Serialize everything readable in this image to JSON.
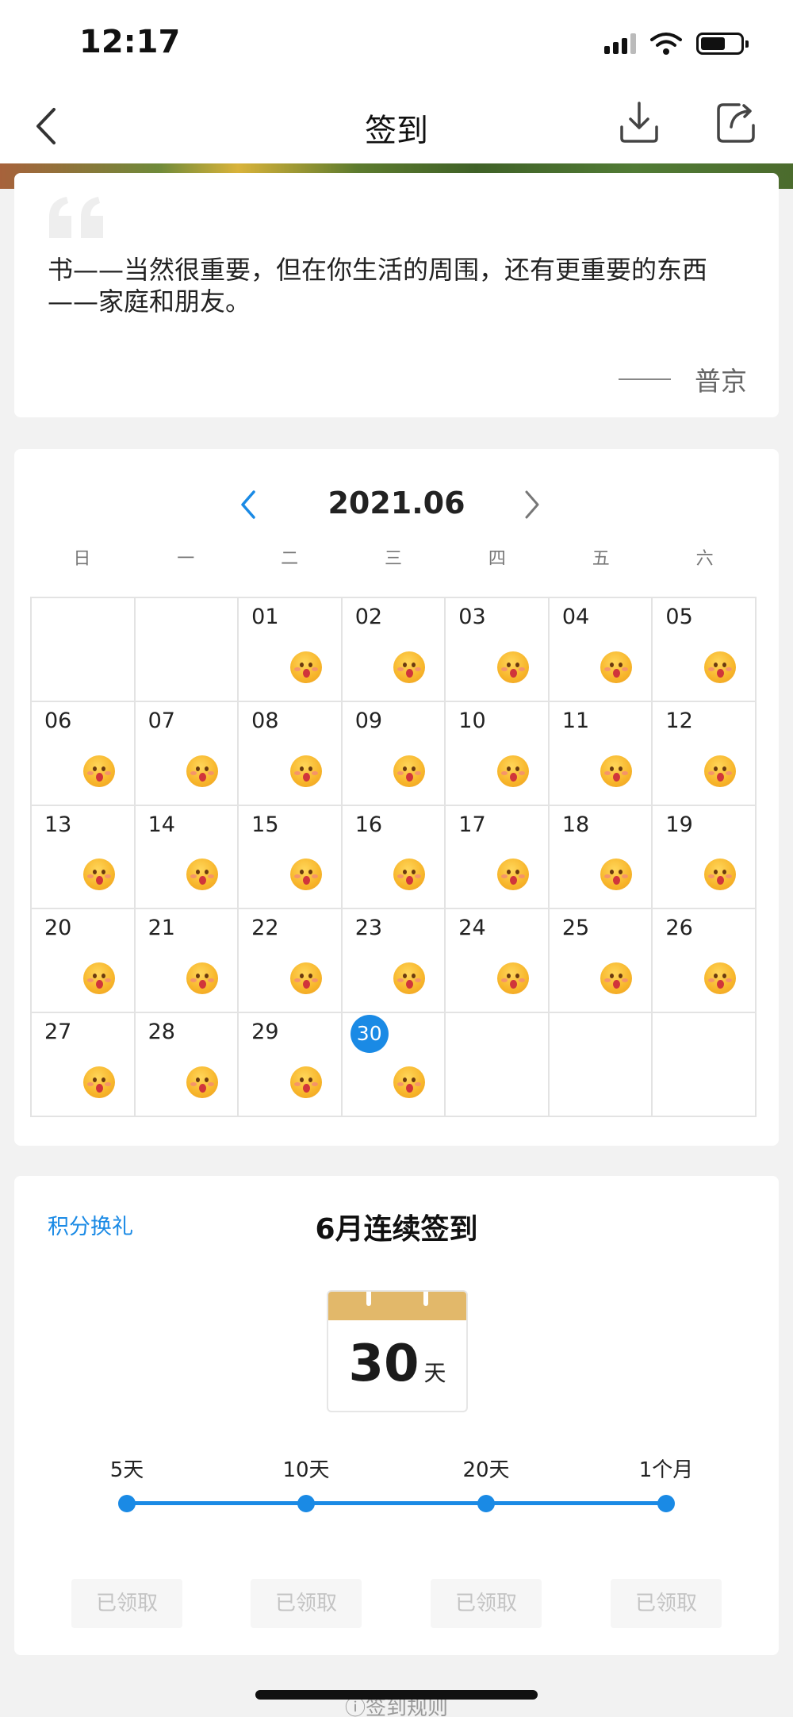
{
  "status_bar": {
    "time": "12:17"
  },
  "nav": {
    "title": "签到"
  },
  "quote": {
    "text": "书——当然很重要，但在你生活的周围，还有更重要的东西——家庭和朋友。",
    "author": "普京"
  },
  "calendar": {
    "month": "2021.06",
    "weekdays": [
      "日",
      "一",
      "二",
      "三",
      "四",
      "五",
      "六"
    ],
    "leading_blank_cells": 2,
    "days": [
      "01",
      "02",
      "03",
      "04",
      "05",
      "06",
      "07",
      "08",
      "09",
      "10",
      "11",
      "12",
      "13",
      "14",
      "15",
      "16",
      "17",
      "18",
      "19",
      "20",
      "21",
      "22",
      "23",
      "24",
      "25",
      "26",
      "27",
      "28",
      "29",
      "30"
    ],
    "signed_days": [
      "01",
      "02",
      "03",
      "04",
      "05",
      "06",
      "07",
      "08",
      "09",
      "10",
      "11",
      "12",
      "13",
      "14",
      "15",
      "16",
      "17",
      "18",
      "19",
      "20",
      "21",
      "22",
      "23",
      "24",
      "25",
      "26",
      "27",
      "28",
      "29",
      "30"
    ],
    "today": "30",
    "sign_icon": "smiley-face-icon"
  },
  "streak": {
    "points_link": "积分换礼",
    "title": "6月连续签到",
    "days": "30",
    "days_unit": "天",
    "milestones": [
      {
        "label": "5天",
        "button": "已领取"
      },
      {
        "label": "10天",
        "button": "已领取"
      },
      {
        "label": "20天",
        "button": "已领取"
      },
      {
        "label": "1个月",
        "button": "已领取"
      }
    ]
  },
  "rules": {
    "label": "签到规则"
  },
  "colors": {
    "accent": "#1a8ae5",
    "calendar_header": "#e2b86a"
  }
}
